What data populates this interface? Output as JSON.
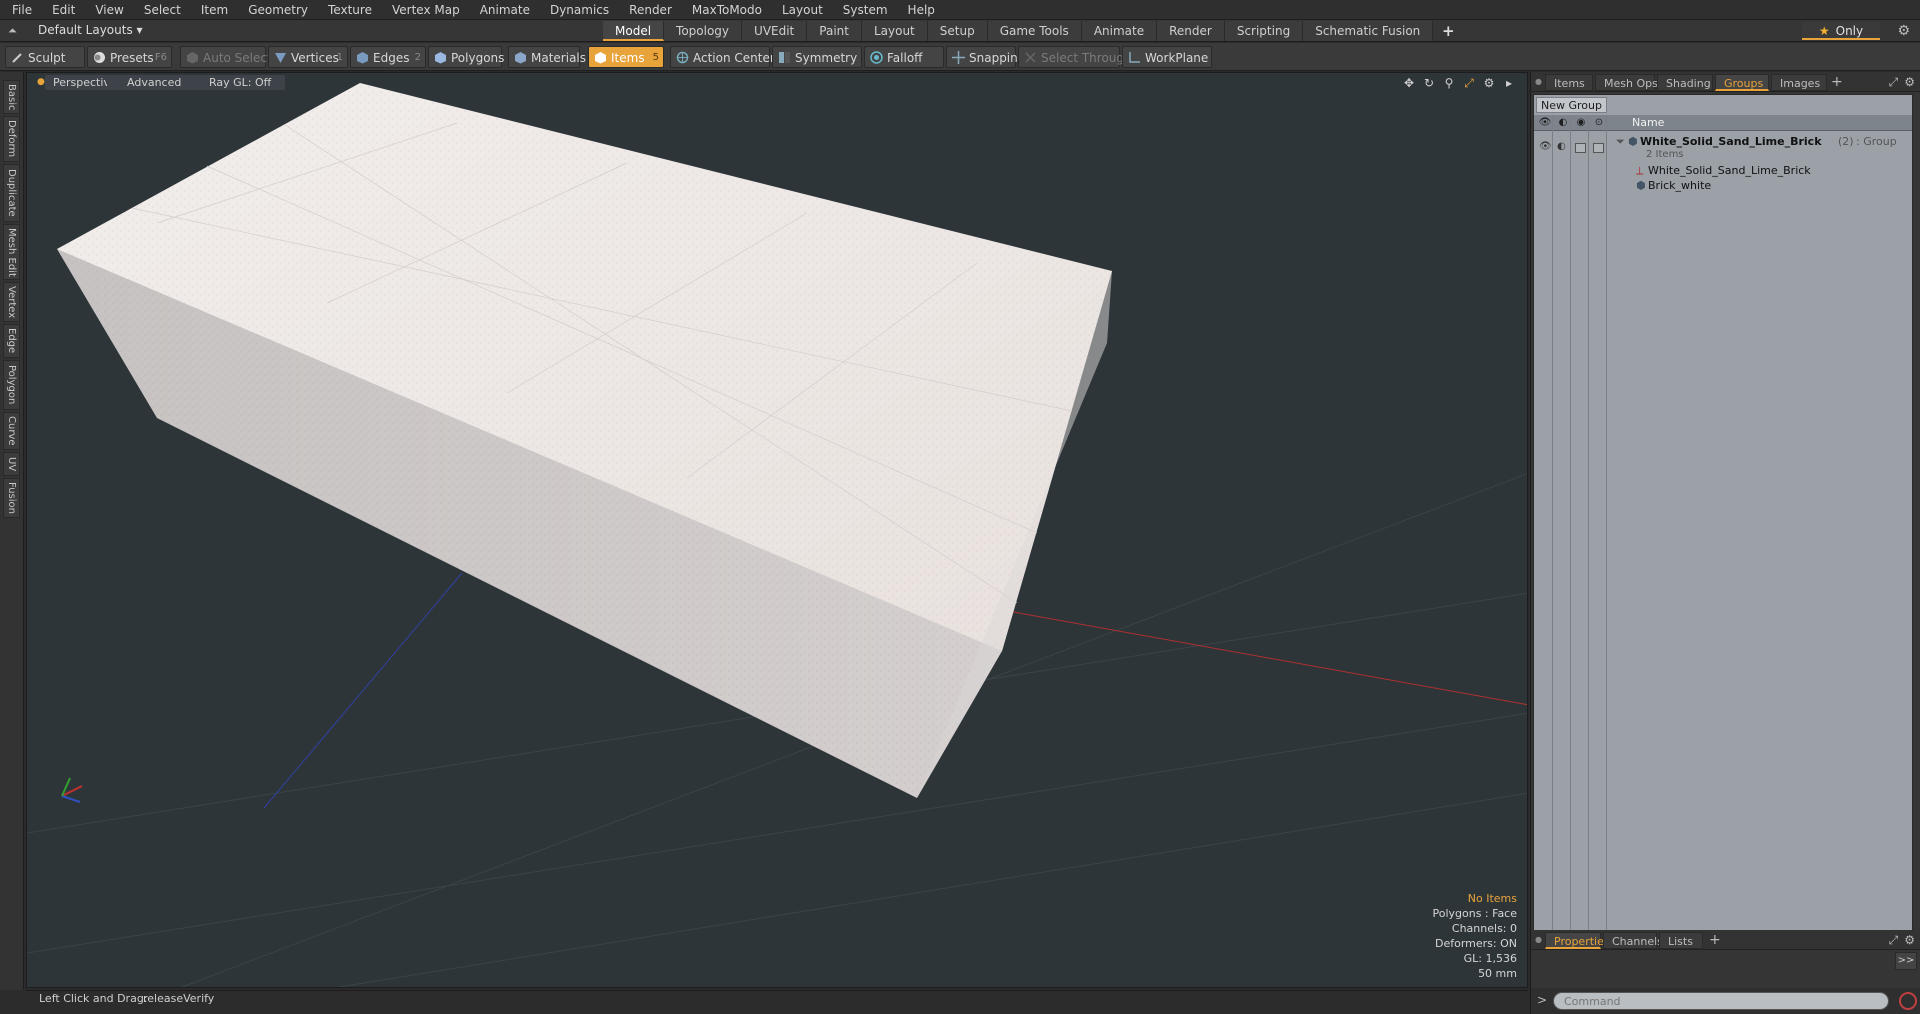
{
  "menu": [
    "File",
    "Edit",
    "View",
    "Select",
    "Item",
    "Geometry",
    "Texture",
    "Vertex Map",
    "Animate",
    "Dynamics",
    "Render",
    "MaxToModo",
    "Layout",
    "System",
    "Help"
  ],
  "layout": {
    "select": "Default Layouts ▾",
    "tabs": [
      "Model",
      "Topology",
      "UVEdit",
      "Paint",
      "Layout",
      "Setup",
      "Game Tools",
      "Animate",
      "Render",
      "Scripting",
      "Schematic Fusion"
    ],
    "active_tab": "Model",
    "only_label": "Only"
  },
  "toolbar": {
    "sculpt": "Sculpt",
    "presets": "Presets",
    "presets_key": "F6",
    "auto_select": "Auto Select",
    "vertices": "Vertices",
    "vertices_key": "1",
    "edges": "Edges",
    "edges_key": "2",
    "polygons": "Polygons",
    "materials": "Materials",
    "items": "Items",
    "items_key": "5",
    "action_center": "Action Center",
    "symmetry": "Symmetry",
    "falloff": "Falloff",
    "snapping": "Snapping",
    "select_through": "Select Through",
    "workplane": "WorkPlane"
  },
  "left_tabs": [
    "Basic",
    "Deform",
    "Duplicate",
    "Mesh Edit",
    "Vertex",
    "Edge",
    "Polygon",
    "Curve",
    "UV",
    "Fusion"
  ],
  "viewport": {
    "view": "Perspective",
    "advanced": "Advanced",
    "raygl": "Ray GL: Off",
    "hud": {
      "no_items": "No Items",
      "polygons": "Polygons : Face",
      "channels": "Channels: 0",
      "deformers": "Deformers: ON",
      "gl": "GL: 1,536",
      "unit": "50 mm"
    },
    "colors": {
      "background": "#2e3539",
      "brick_top": "#ece6e4",
      "brick_side": "#cfcac9",
      "x_axis": "#b03030",
      "z_axis": "#3040a0"
    }
  },
  "status": {
    "hint": "Left Click and Drag:",
    "action": "releaseVerify"
  },
  "right_panel": {
    "tabs": [
      "Items",
      "Mesh Ops",
      "Shading",
      "Groups",
      "Images"
    ],
    "active_tab": "Groups",
    "new_group": "New Group",
    "name_header": "Name",
    "group": {
      "name": "White_Solid_Sand_Lime_Brick",
      "count": "(2)",
      "type": ": Group",
      "subtitle": "2 Items",
      "children": [
        {
          "name": "White_Solid_Sand_Lime_Brick",
          "icon": "locator-icon"
        },
        {
          "name": "Brick_white",
          "icon": "mesh-icon"
        }
      ]
    },
    "bottom_tabs": [
      "Properties",
      "Channels",
      "Lists"
    ],
    "bottom_active": "Properties",
    "command_placeholder": "Command"
  }
}
